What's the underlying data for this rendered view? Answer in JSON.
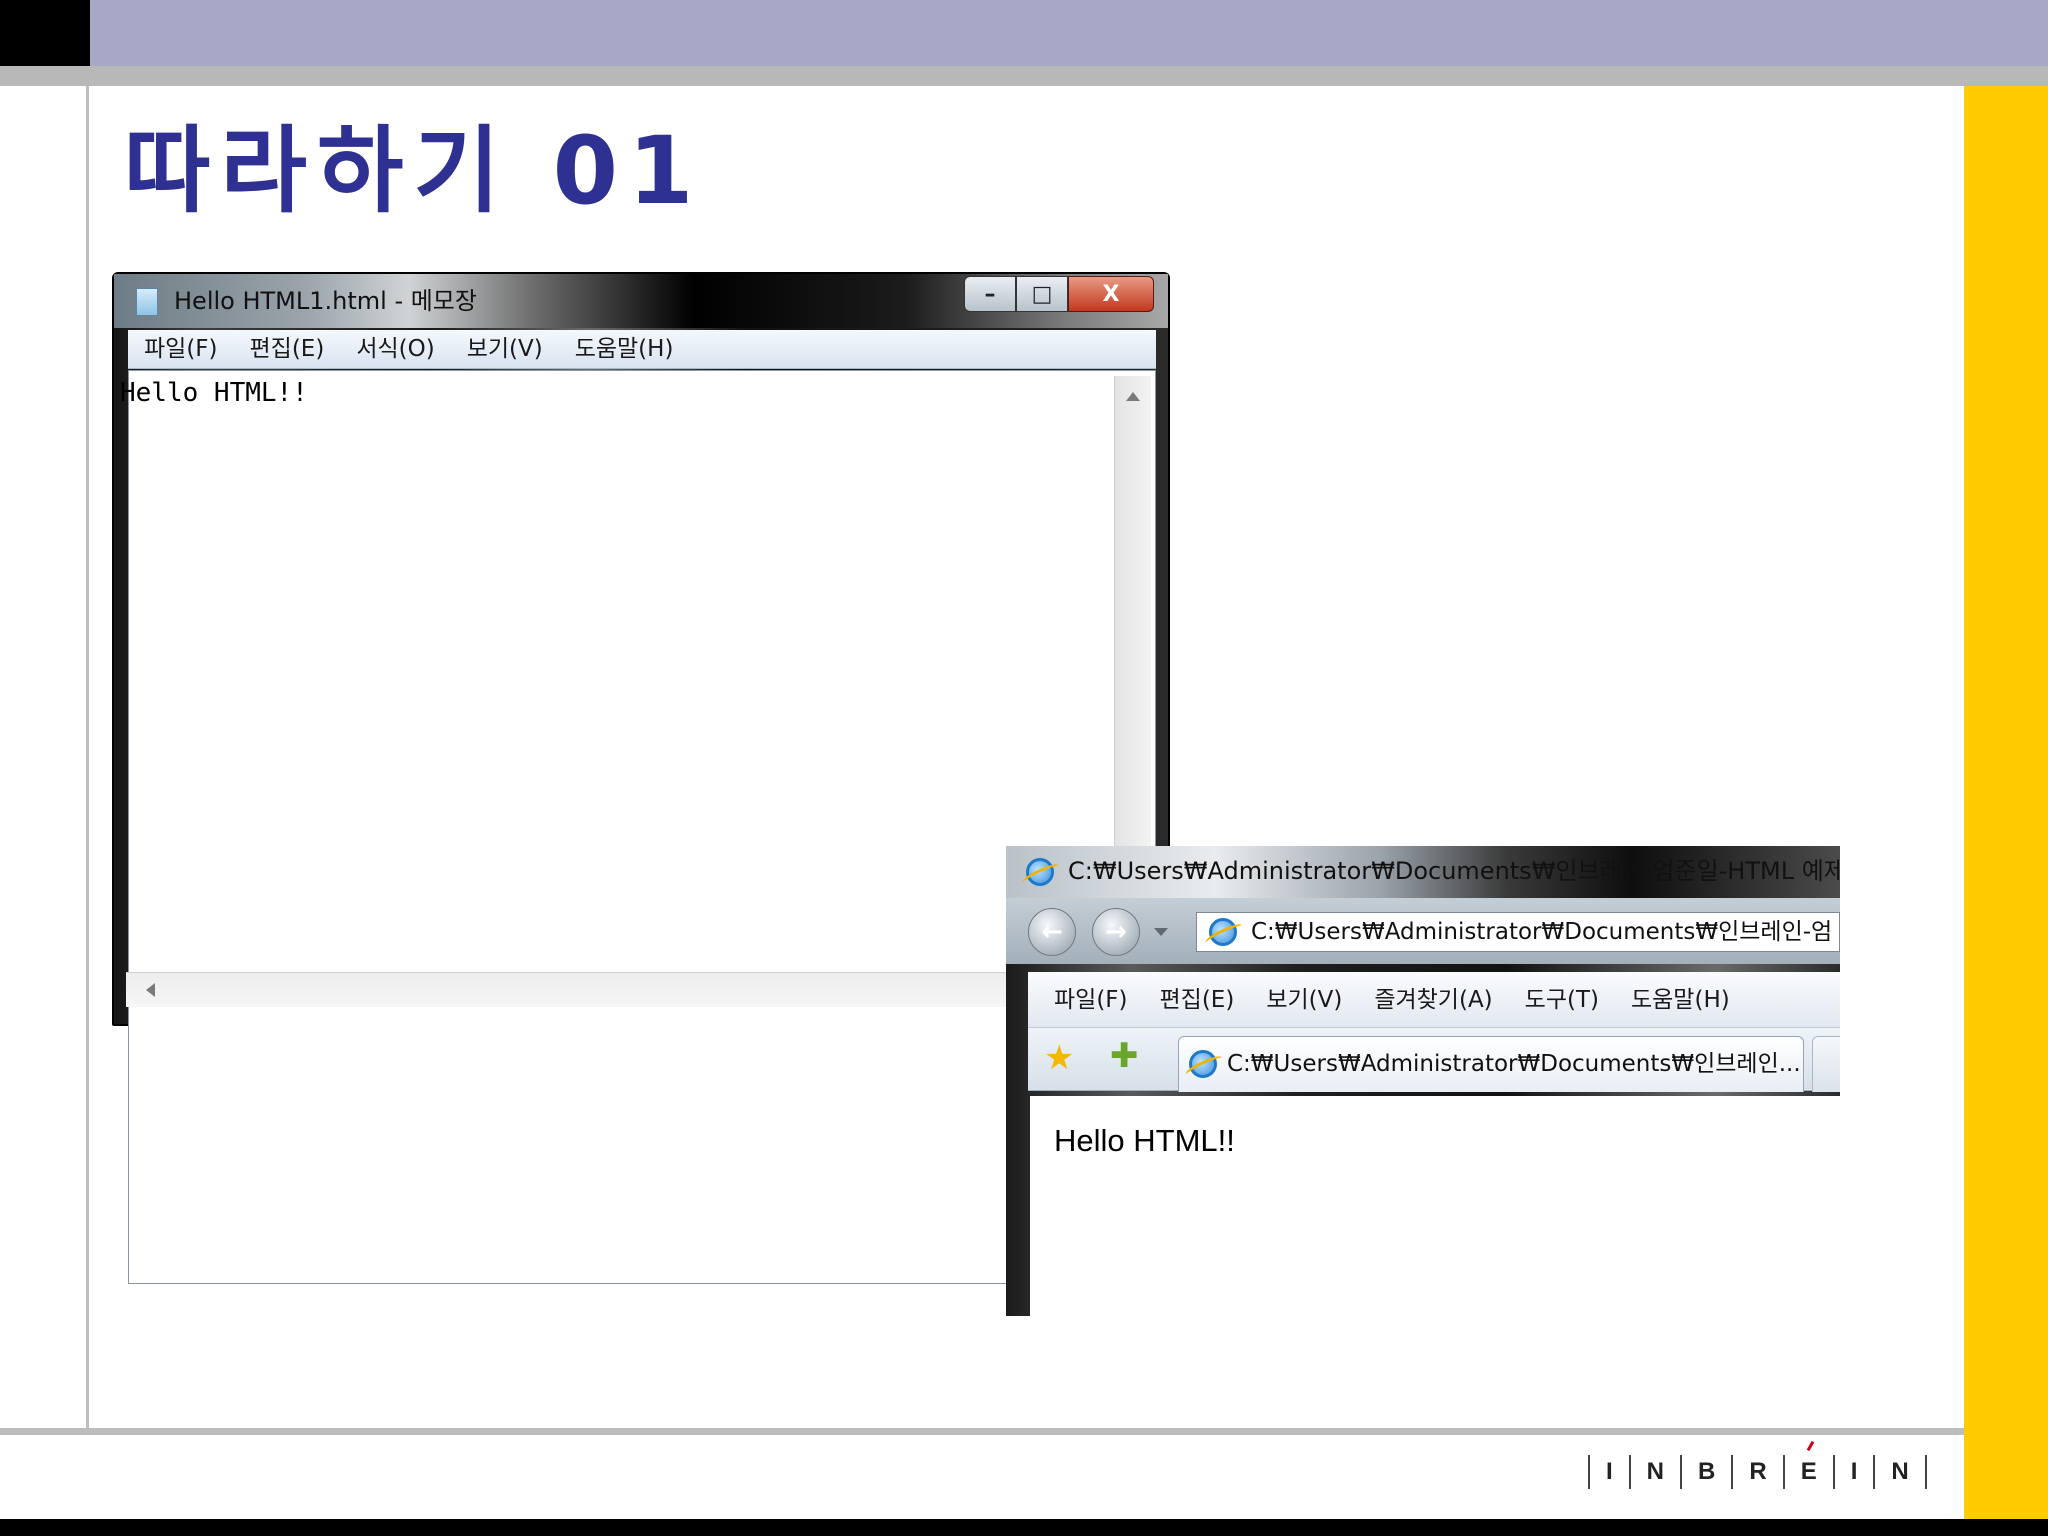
{
  "slide": {
    "title": "따라하기  01",
    "logo_letters": [
      "I",
      "N",
      "B",
      "R",
      "E",
      "I",
      "N"
    ],
    "colors": {
      "title": "#2e3192",
      "top_band": "#a7a7c7",
      "side_bar": "#ffcc00",
      "logo_accent": "#d0021b"
    }
  },
  "notepad": {
    "title": "Hello HTML1.html - 메모장",
    "app_icon": "notepad-icon",
    "controls": {
      "minimize": "–",
      "maximize": "□",
      "close": "X"
    },
    "menu": [
      "파일(F)",
      "편집(E)",
      "서식(O)",
      "보기(V)",
      "도움말(H)"
    ],
    "content": "Hello HTML!!"
  },
  "browser": {
    "title": "C:₩Users₩Administrator₩Documents₩인브레인-엄준일-HTML 예제",
    "app_icon": "ie-icon",
    "nav": {
      "back": "back-arrow-icon",
      "forward": "forward-arrow-icon",
      "back_glyph": "←",
      "forward_glyph": "→"
    },
    "address": "C:₩Users₩Administrator₩Documents₩인브레인-엄",
    "menu": [
      "파일(F)",
      "편집(E)",
      "보기(V)",
      "즐겨찾기(A)",
      "도구(T)",
      "도움말(H)"
    ],
    "favorites_glyph": "★",
    "add_favorite_glyph": "✚",
    "tab_label": "C:₩Users₩Administrator₩Documents₩인브레인...",
    "page_text": "Hello HTML!!"
  }
}
